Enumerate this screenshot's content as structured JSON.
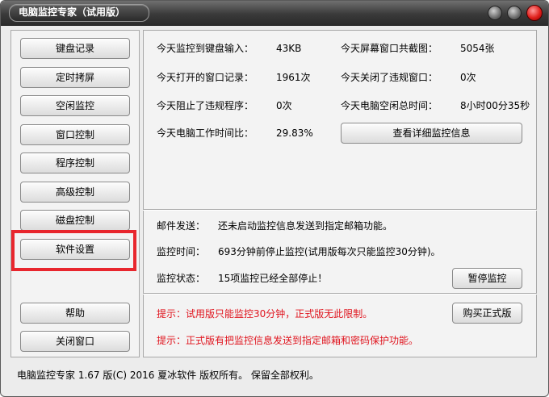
{
  "window": {
    "title": "电脑监控专家（试用版）"
  },
  "sidebar": {
    "items": [
      {
        "label": "键盘记录"
      },
      {
        "label": "定时拷屏"
      },
      {
        "label": "空闲监控"
      },
      {
        "label": "窗口控制"
      },
      {
        "label": "程序控制"
      },
      {
        "label": "高级控制"
      },
      {
        "label": "磁盘控制"
      },
      {
        "label": "软件设置",
        "highlighted": true
      },
      {
        "label": "帮助"
      },
      {
        "label": "关闭窗口"
      }
    ]
  },
  "stats": {
    "keyboard_label": "今天监控到键盘输入：",
    "keyboard_value": "43KB",
    "screenshots_label": "今天屏幕窗口共截图：",
    "screenshots_value": "5054张",
    "windows_opened_label": "今天打开的窗口记录：",
    "windows_opened_value": "1961次",
    "windows_closed_label": "今天关闭了违规窗口：",
    "windows_closed_value": "0次",
    "programs_blocked_label": "今天阻止了违规程序：",
    "programs_blocked_value": "0次",
    "idle_time_label": "今天电脑空闲总时间：",
    "idle_time_value": "8小时00分35秒",
    "work_ratio_label": "今天电脑工作时间比：",
    "work_ratio_value": "29.83%",
    "details_button": "查看详细监控信息"
  },
  "status": {
    "mail_label": "邮件发送：",
    "mail_value": "还未启动监控信息发送到指定邮箱功能。",
    "time_label": "监控时间：",
    "time_value": "693分钟前停止监控(试用版每次只能监控30分钟)。",
    "state_label": "监控状态：",
    "state_value": "15项监控已经全部停止！",
    "pause_button": "暂停监控"
  },
  "notices": {
    "notice1": "提示：试用版只能监控30分钟，正式版无此限制。",
    "notice2": "提示：正式版有把监控信息发送到指定邮箱和密码保护功能。",
    "buy_button": "购买正式版"
  },
  "footer": {
    "copyright": "电脑监控专家  1.67  版(C)  2016 夏冰软件 版权所有。 保留全部权利。"
  },
  "colors": {
    "highlight": "#e8262d",
    "notice_text": "#e0141e",
    "close_button": "#e0201c"
  }
}
